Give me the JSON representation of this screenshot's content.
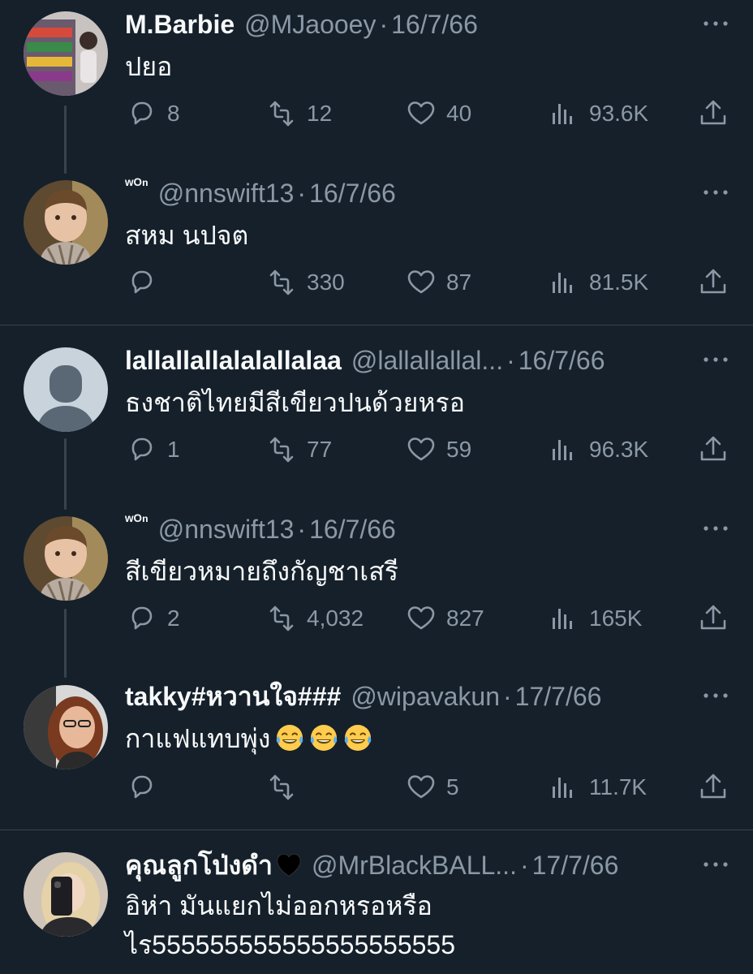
{
  "colors": {
    "background": "#15202b",
    "primary_text": "#f7f9f9",
    "secondary_text": "#8b98a5",
    "line": "#38444d"
  },
  "icons": [
    "reply-icon",
    "retweet-icon",
    "like-icon",
    "views-icon",
    "share-icon",
    "more-icon"
  ],
  "tweets": [
    {
      "name": "M.Barbie",
      "handle": "@MJaooey",
      "dot": "·",
      "date": "16/7/66",
      "text": "ปยอ",
      "replies": "8",
      "retweets": "12",
      "likes": "40",
      "views": "93.6K"
    },
    {
      "name": "ʷᴼⁿ",
      "handle": "@nnswift13",
      "dot": "·",
      "date": "16/7/66",
      "text": "สหม นปจต",
      "replies": "",
      "retweets": "330",
      "likes": "87",
      "views": "81.5K"
    },
    {
      "name": "lallallallalalallalaa",
      "handle": "@lallallallal...",
      "dot": "·",
      "date": "16/7/66",
      "text": "ธงชาติไทยมีสีเขียวปนด้วยหรอ",
      "replies": "1",
      "retweets": "77",
      "likes": "59",
      "views": "96.3K"
    },
    {
      "name": "ʷᴼⁿ",
      "handle": "@nnswift13",
      "dot": "·",
      "date": "16/7/66",
      "text": "สีเขียวหมายถึงกัญชาเสรี",
      "replies": "2",
      "retweets": "4,032",
      "likes": "827",
      "views": "165K"
    },
    {
      "name": "takky#หวานใจ###",
      "handle": "@wipavakun",
      "dot": "·",
      "date": "17/7/66",
      "text": "กาแฟแทบพุ่ง",
      "emoji": "face-with-tears-of-joy",
      "replies": "",
      "retweets": "",
      "likes": "5",
      "views": "11.7K"
    },
    {
      "name": "คุณลูกโป่งดำ",
      "name_emoji": "black-heart",
      "handle": "@MrBlackBALL...",
      "dot": "·",
      "date": "17/7/66",
      "text_line1": "อิห่า มันแยกไม่ออกหรอหรือ",
      "text_line2": "ไร555555555555555555555"
    }
  ]
}
